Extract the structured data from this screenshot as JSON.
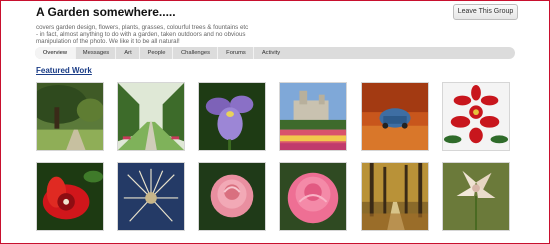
{
  "group": {
    "title": "A Garden somewhere.....",
    "leave_button": "Leave This Group",
    "description_line1": "covers garden design, flowers, plants, grasses, colourful trees & fountains etc",
    "description_line2": "- in fact, almost anything to do with a garden, taken outdoors and no obvious",
    "description_line3": "manipulation of the photo. We like it to be all natural!"
  },
  "tabs": [
    "Overview",
    "Messages",
    "Art",
    "People",
    "Challenges",
    "Forums",
    "Activity"
  ],
  "active_tab": "Overview",
  "featured": {
    "heading": "Featured Work",
    "items": [
      {
        "subject": "tree-lined-garden"
      },
      {
        "subject": "hedge-avenue-garden"
      },
      {
        "subject": "purple-iris"
      },
      {
        "subject": "castle-flower-garden"
      },
      {
        "subject": "autumn-vw-beetle"
      },
      {
        "subject": "red-poinsettia"
      },
      {
        "subject": "red-passion-flower"
      },
      {
        "subject": "dried-seed-head"
      },
      {
        "subject": "pink-rose"
      },
      {
        "subject": "pink-rose-bloom"
      },
      {
        "subject": "autumn-forest-path"
      },
      {
        "subject": "pale-lily"
      }
    ]
  },
  "colors": {
    "frame_border": "#c8102e",
    "link": "#1a3c86",
    "tab_bar": "#dcdcdc"
  }
}
